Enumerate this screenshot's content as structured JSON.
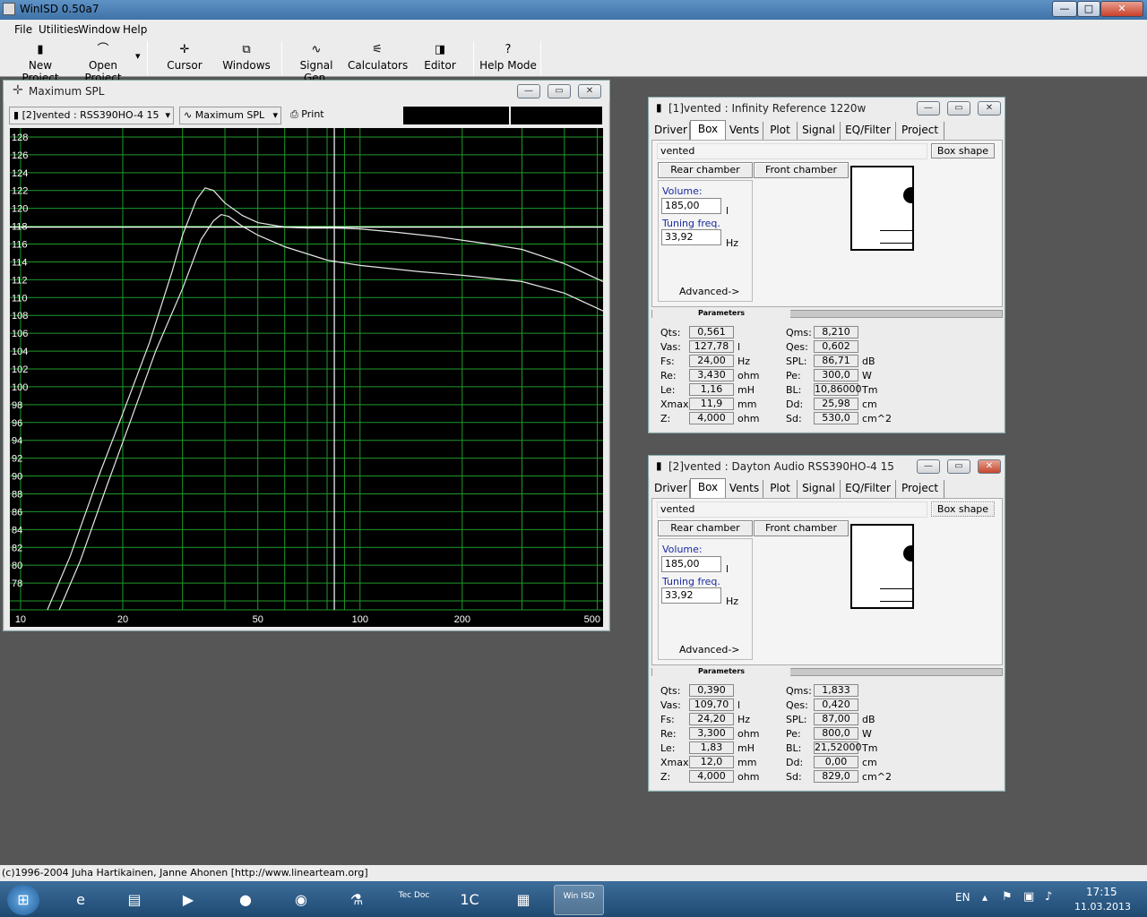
{
  "app": {
    "title": "WinISD 0.50a7",
    "title_buttons": {
      "minimize": "—",
      "maximize": "□",
      "close": "✕"
    }
  },
  "menu": [
    "File",
    "Utilities",
    "Window",
    "Help"
  ],
  "toolbar": [
    {
      "label": "New Project",
      "icon": "new-project-icon",
      "glyph": "▮"
    },
    {
      "label": "Open Project",
      "icon": "open-project-icon",
      "glyph": "⌒",
      "dropdown": "▾"
    },
    {
      "label": "Cursor",
      "icon": "cursor-icon",
      "glyph": "✛"
    },
    {
      "label": "Windows",
      "icon": "windows-icon",
      "glyph": "⧉"
    },
    {
      "label": "Signal Gen.",
      "icon": "signal-gen-icon",
      "glyph": "∿"
    },
    {
      "label": "Calculators",
      "icon": "calculators-icon",
      "glyph": "⚟"
    },
    {
      "label": "Editor",
      "icon": "editor-icon",
      "glyph": "◨"
    },
    {
      "label": "Help Mode",
      "icon": "help-mode-icon",
      "glyph": "?"
    }
  ],
  "spl_window": {
    "title": "Maximum SPL",
    "project_select": "[2]vented : RSS390HO-4 15",
    "graph_select": "Maximum SPL",
    "print_label": "Print",
    "dropdown_glyph": "▾"
  },
  "chart_data": {
    "type": "line",
    "title": "Maximum SPL",
    "x_scale": "log",
    "xlim": [
      9.3,
      520
    ],
    "ylim": [
      75,
      129
    ],
    "x_tick_labels": [
      "10",
      "20",
      "50",
      "100",
      "200",
      "500"
    ],
    "y_tick_labels": [
      "128",
      "126",
      "124",
      "122",
      "120",
      "118",
      "116",
      "114",
      "112",
      "110",
      "108",
      "106",
      "104",
      "102",
      "100",
      "98",
      "96",
      "94",
      "92",
      "90",
      "88",
      "86",
      "84",
      "82",
      "80",
      "78"
    ],
    "background": "#000000",
    "grid_color": "#1f9a2a",
    "curve_color": "#e6e6e6",
    "cursor_x": 84,
    "cursor_y": 117.9,
    "series": [
      {
        "values": [
          [
            12,
            75
          ],
          [
            14,
            81
          ],
          [
            17,
            90
          ],
          [
            20,
            97
          ],
          [
            24,
            105
          ],
          [
            28,
            113
          ],
          [
            30,
            117
          ],
          [
            33,
            121
          ],
          [
            35,
            122.3
          ],
          [
            37,
            122
          ],
          [
            40,
            120.6
          ],
          [
            45,
            119.2
          ],
          [
            50,
            118.4
          ],
          [
            60,
            117.9
          ],
          [
            70,
            117.8
          ],
          [
            84,
            117.8
          ],
          [
            100,
            117.7
          ],
          [
            130,
            117.3
          ],
          [
            170,
            116.8
          ],
          [
            230,
            116.1
          ],
          [
            300,
            115.4
          ],
          [
            400,
            113.8
          ],
          [
            520,
            111.8
          ]
        ]
      },
      {
        "values": [
          [
            13,
            75
          ],
          [
            15,
            80.5
          ],
          [
            18,
            89
          ],
          [
            21,
            96
          ],
          [
            25,
            104
          ],
          [
            30,
            111
          ],
          [
            34,
            116.5
          ],
          [
            37,
            118.6
          ],
          [
            39,
            119.3
          ],
          [
            41,
            119.1
          ],
          [
            45,
            118
          ],
          [
            50,
            117
          ],
          [
            60,
            115.7
          ],
          [
            80,
            114.2
          ],
          [
            100,
            113.6
          ],
          [
            150,
            112.9
          ],
          [
            200,
            112.5
          ],
          [
            300,
            111.8
          ],
          [
            400,
            110.5
          ],
          [
            520,
            108.5
          ]
        ]
      }
    ]
  },
  "boxwin1": {
    "title": "[1]vented : Infinity Reference 1220w",
    "tabs": [
      "Driver",
      "Box",
      "Vents",
      "Plot",
      "Signal",
      "EQ/Filter",
      "Project"
    ],
    "box_type": "vented",
    "box_shape_label": "Box shape",
    "rear_chamber_label": "Rear chamber",
    "front_chamber_label": "Front chamber",
    "volume_label": "Volume:",
    "volume_value": "185,00",
    "volume_unit": "l",
    "tuning_label": "Tuning freq.",
    "tuning_value": "33,92",
    "tuning_unit": "Hz",
    "advanced_label": "Advanced->",
    "params_label": "Parameters",
    "left_params": [
      {
        "name": "Qts:",
        "value": "0,561",
        "unit": ""
      },
      {
        "name": "Vas:",
        "value": "127,78",
        "unit": "l"
      },
      {
        "name": "Fs:",
        "value": "24,00",
        "unit": "Hz"
      },
      {
        "name": "Re:",
        "value": "3,430",
        "unit": "ohm"
      },
      {
        "name": "Le:",
        "value": "1,16",
        "unit": "mH"
      },
      {
        "name": "Xmax:",
        "value": "11,9",
        "unit": "mm"
      },
      {
        "name": "Z:",
        "value": "4,000",
        "unit": "ohm"
      }
    ],
    "right_params": [
      {
        "name": "Qms:",
        "value": "8,210",
        "unit": ""
      },
      {
        "name": "Qes:",
        "value": "0,602",
        "unit": ""
      },
      {
        "name": "SPL:",
        "value": "86,71",
        "unit": "dB"
      },
      {
        "name": "Pe:",
        "value": "300,0",
        "unit": "W"
      },
      {
        "name": "BL:",
        "value": "10,86000",
        "unit": "Tm"
      },
      {
        "name": "Dd:",
        "value": "25,98",
        "unit": "cm"
      },
      {
        "name": "Sd:",
        "value": "530,0",
        "unit": "cm^2"
      }
    ]
  },
  "boxwin2": {
    "title": "[2]vented : Dayton Audio RSS390HO-4 15",
    "tabs": [
      "Driver",
      "Box",
      "Vents",
      "Plot",
      "Signal",
      "EQ/Filter",
      "Project"
    ],
    "box_type": "vented",
    "box_shape_label": "Box shape",
    "rear_chamber_label": "Rear chamber",
    "front_chamber_label": "Front chamber",
    "volume_label": "Volume:",
    "volume_value": "185,00",
    "volume_unit": "l",
    "tuning_label": "Tuning freq.",
    "tuning_value": "33,92",
    "tuning_unit": "Hz",
    "advanced_label": "Advanced->",
    "params_label": "Parameters",
    "left_params": [
      {
        "name": "Qts:",
        "value": "0,390",
        "unit": ""
      },
      {
        "name": "Vas:",
        "value": "109,70",
        "unit": "l"
      },
      {
        "name": "Fs:",
        "value": "24,20",
        "unit": "Hz"
      },
      {
        "name": "Re:",
        "value": "3,300",
        "unit": "ohm"
      },
      {
        "name": "Le:",
        "value": "1,83",
        "unit": "mH"
      },
      {
        "name": "Xmax:",
        "value": "12,0",
        "unit": "mm"
      },
      {
        "name": "Z:",
        "value": "4,000",
        "unit": "ohm"
      }
    ],
    "right_params": [
      {
        "name": "Qms:",
        "value": "1,833",
        "unit": ""
      },
      {
        "name": "Qes:",
        "value": "0,420",
        "unit": ""
      },
      {
        "name": "SPL:",
        "value": "87,00",
        "unit": "dB"
      },
      {
        "name": "Pe:",
        "value": "800,0",
        "unit": "W"
      },
      {
        "name": "BL:",
        "value": "21,52000",
        "unit": "Tm"
      },
      {
        "name": "Dd:",
        "value": "0,00",
        "unit": "cm"
      },
      {
        "name": "Sd:",
        "value": "829,0",
        "unit": "cm^2"
      }
    ]
  },
  "status": "(c)1996-2004 Juha Hartikainen, Janne Ahonen [http://www.linearteam.org]",
  "taskbar": {
    "apps": [
      {
        "name": "start-button",
        "glyph": "⊞"
      },
      {
        "name": "internet-explorer-icon",
        "glyph": "e"
      },
      {
        "name": "explorer-icon",
        "glyph": "▤"
      },
      {
        "name": "media-player-icon",
        "glyph": "▶"
      },
      {
        "name": "firefox-icon",
        "glyph": "●"
      },
      {
        "name": "chrome-icon",
        "glyph": "◉"
      },
      {
        "name": "app-icon",
        "glyph": "⚗"
      },
      {
        "name": "tecdoc-icon",
        "glyph": "Tec Doc"
      },
      {
        "name": "app2-icon",
        "glyph": "1C"
      },
      {
        "name": "calculator-icon",
        "glyph": "▦"
      },
      {
        "name": "winisd-icon",
        "glyph": "Win ISD"
      }
    ],
    "lang": "EN",
    "time": "17:15",
    "date": "11.03.2013"
  }
}
